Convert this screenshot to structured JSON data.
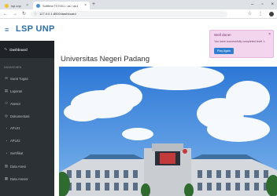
{
  "browser": {
    "tabs": [
      {
        "label": "lsp unp",
        "active": false
      },
      {
        "label": "Softfest T07001 / as / as1",
        "active": true
      }
    ],
    "url": "127.0.0.1:8000/dashboard",
    "window_controls": [
      "minimize",
      "maximize",
      "close"
    ],
    "colors": {
      "tabbar": "#dee1e6"
    }
  },
  "app": {
    "brand": "LSP UNP",
    "colors": {
      "brand": "#2b6fa8",
      "sidebar": "#2c3136",
      "sidebar_active": "#1f2327"
    }
  },
  "sidebar": {
    "active_item": {
      "label": "Dashboard",
      "icon": "dashboard-icon"
    },
    "section_label": "MANAGEMEN",
    "items": [
      {
        "label": "Surat Tugas",
        "icon": "mail-icon"
      },
      {
        "label": "Laporan",
        "icon": "report-icon"
      },
      {
        "label": "Asesor",
        "icon": "user-icon"
      },
      {
        "label": "Dokumentasi",
        "icon": "camera-icon"
      },
      {
        "label": "APL01",
        "icon": "document-icon"
      },
      {
        "label": "APL02",
        "icon": "document-icon"
      },
      {
        "label": "Sertifikat",
        "icon": "certificate-icon"
      },
      {
        "label": "Data Asesi",
        "icon": "users-icon"
      },
      {
        "label": "Data Asesor",
        "icon": "table-icon"
      }
    ]
  },
  "main": {
    "title": "Universitas Negeri Padang"
  },
  "toast": {
    "title": "Well done!",
    "message": "You have successfully completed level 1.",
    "button": "Play Again",
    "colors": {
      "background": "#f3d6ee",
      "button": "#2e7fd1"
    }
  }
}
